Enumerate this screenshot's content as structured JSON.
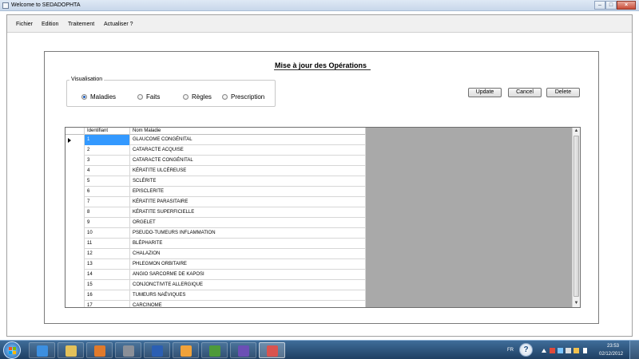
{
  "window": {
    "title": "Welcome to SEDADOPHTA"
  },
  "menu": {
    "items": [
      "Fichier",
      "Edition",
      "Traitement",
      "Actualiser ?"
    ]
  },
  "panel": {
    "title": "Mise à jour des Opérations"
  },
  "visualisation": {
    "label": "Visualisation",
    "options": [
      {
        "label": "Maladies",
        "selected": true
      },
      {
        "label": "Faits",
        "selected": false
      },
      {
        "label": "Règles",
        "selected": false
      },
      {
        "label": "Prescription",
        "selected": false
      }
    ]
  },
  "buttons": {
    "update": "Update",
    "cancel": "Cancel",
    "delete": "Delete"
  },
  "grid": {
    "columns": [
      "Identifiant",
      "Nom Maladie"
    ],
    "rows": [
      [
        "1",
        "GLAUCOME CONGÉNITAL"
      ],
      [
        "2",
        "CATARACTE ACQUISE"
      ],
      [
        "3",
        "CATARACTE CONGÉNITAL"
      ],
      [
        "4",
        "KÉRATITE ULCÉREUSE"
      ],
      [
        "5",
        "SCLÉRITE"
      ],
      [
        "6",
        "EPISCLERITE"
      ],
      [
        "7",
        "KÉRATITE PARASITAIRE"
      ],
      [
        "8",
        "KÉRATITE SUPERFICIELLE"
      ],
      [
        "9",
        "ORGELET"
      ],
      [
        "10",
        "PSEUDO-TUMEURS INFLAMMATION"
      ],
      [
        "11",
        "BLÉPHARITE"
      ],
      [
        "12",
        "CHALAZION"
      ],
      [
        "13",
        "PHLEGMON ORBITAIRE"
      ],
      [
        "14",
        "ANGIO SARCORME DE KAPOSI"
      ],
      [
        "15",
        "CONJONCTIVITE ALLERGIQUE"
      ],
      [
        "16",
        "TUMEURS NAÉVIQUES"
      ],
      [
        "17",
        "CARCINOME"
      ]
    ],
    "selected_row": 0
  },
  "taskbar": {
    "language": "FR",
    "time": "23:53",
    "date": "02/12/2012",
    "tasks": [
      {
        "icon": "internet-explorer-icon",
        "color": "#3c8fe0"
      },
      {
        "icon": "folder-icon",
        "color": "#e3c15a"
      },
      {
        "icon": "media-player-icon",
        "color": "#e07a2c"
      },
      {
        "icon": "tools-icon",
        "color": "#8a8f98"
      },
      {
        "icon": "word-icon",
        "color": "#2b5fb3"
      },
      {
        "icon": "pen-icon",
        "color": "#f0a23a"
      },
      {
        "icon": "books-icon",
        "color": "#4d9a3a"
      },
      {
        "icon": "visual-studio-icon",
        "color": "#6b4fb5"
      },
      {
        "icon": "windows-form-icon",
        "color": "#d9534f"
      }
    ]
  },
  "colors": {
    "selection": "#3399ff",
    "grid_background": "#a9a9a9"
  }
}
